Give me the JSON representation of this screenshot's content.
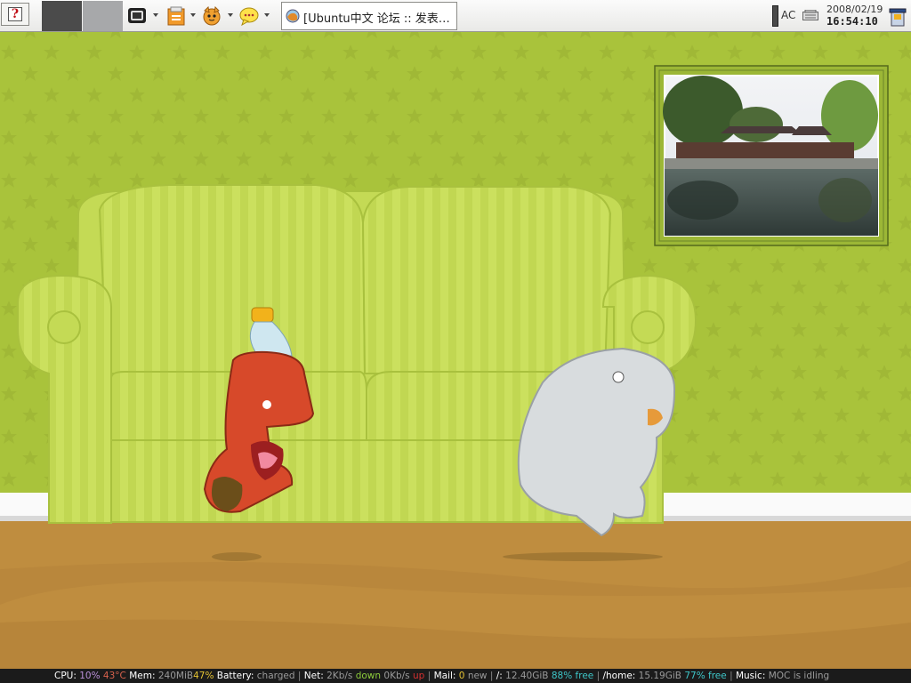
{
  "panel": {
    "menu_glyph": "?",
    "launchers": [
      "terminal-icon",
      "text-editor-icon",
      "firefox-icon",
      "chat-icon"
    ],
    "task": {
      "title": "[Ubuntu中文 论坛 :: 发表…",
      "icon": "firefox-small-icon"
    },
    "power": "AC",
    "date": "2008/02/19",
    "time": "16:54:10"
  },
  "status_bar": {
    "cpu_label": "CPU:",
    "cpu_usage": "10%",
    "cpu_temp": "43°C",
    "mem_label": "Mem:",
    "mem_used": "240MiB",
    "mem_pct": "47%",
    "battery_label": "Battery:",
    "battery_state": "charged",
    "net_label": "Net:",
    "net_down_rate": "2Kb/s",
    "net_down": "down",
    "net_up_rate": "0Kb/s",
    "net_up": "up",
    "mail_label": "Mail:",
    "mail_count": "0",
    "mail_new": "new",
    "root_label": "/:",
    "root_size": "12.40GiB",
    "root_free_pct": "88%",
    "root_free": "free",
    "home_label": "/home:",
    "home_size": "15.19GiB",
    "home_free_pct": "77%",
    "home_free": "free",
    "music_label": "Music:",
    "music_state": "MOC is idling",
    "separator": "|"
  },
  "colors": {
    "wall": "#a9c33b",
    "floor": "#bf8d3f",
    "sofa": "#c8de5c",
    "status_bg": "#1b1b1b"
  }
}
